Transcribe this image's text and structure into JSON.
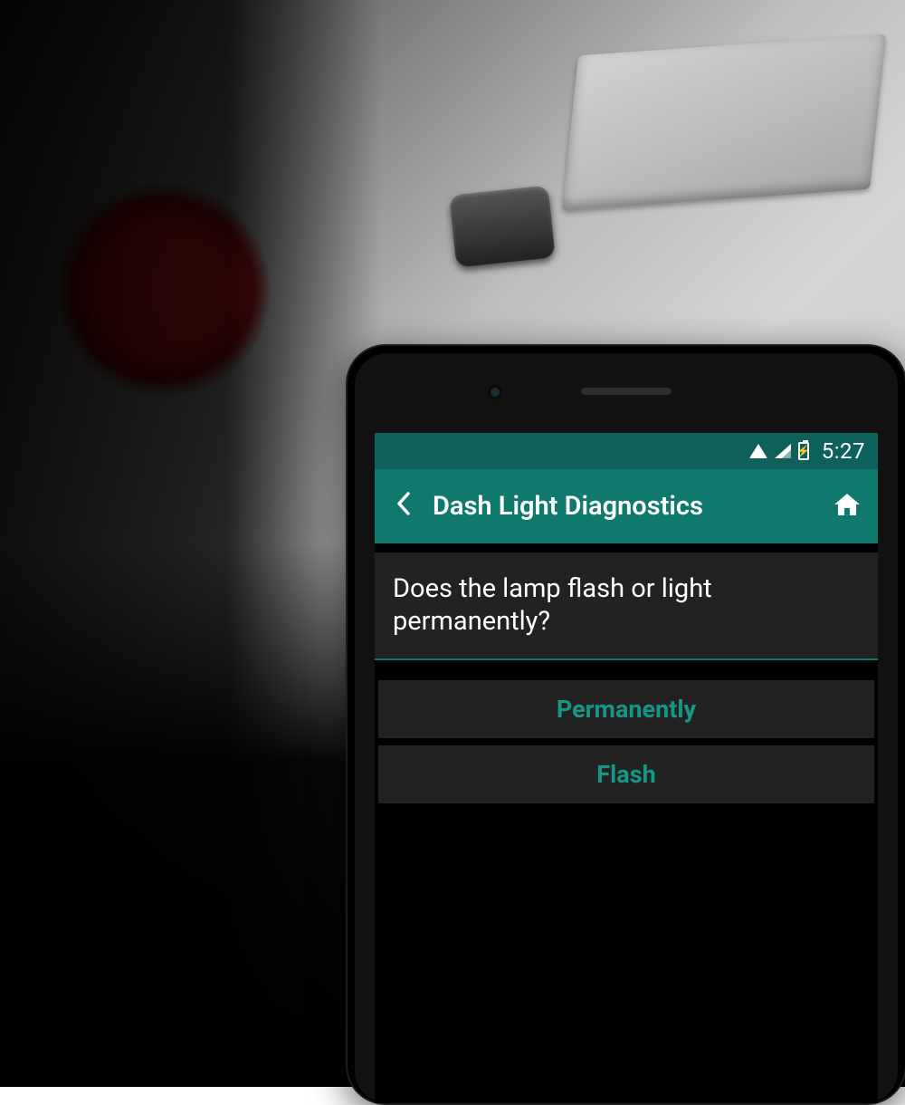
{
  "statusbar": {
    "time": "5:27"
  },
  "appbar": {
    "title": "Dash Light Diagnostics"
  },
  "question": {
    "text": "Does the lamp flash or light permanently?"
  },
  "options": {
    "permanently": "Permanently",
    "flash": "Flash"
  }
}
